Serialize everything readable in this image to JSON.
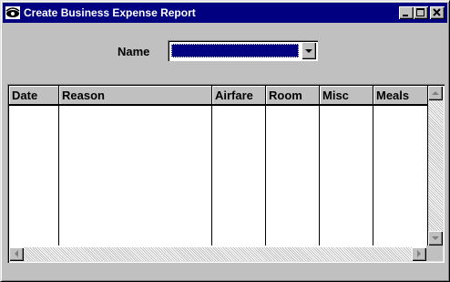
{
  "window": {
    "title": "Create Business Expense Report"
  },
  "form": {
    "name_label": "Name",
    "name_value": ""
  },
  "grid": {
    "columns": [
      {
        "label": "Date"
      },
      {
        "label": "Reason"
      },
      {
        "label": "Airfare"
      },
      {
        "label": "Room"
      },
      {
        "label": "Misc"
      },
      {
        "label": "Meals"
      }
    ],
    "rows": []
  },
  "icons": {
    "app": "eye-icon",
    "minimize": "minimize-icon",
    "maximize": "maximize-icon",
    "close": "close-icon",
    "dropdown": "chevron-down-icon"
  },
  "colors": {
    "titlebar": "#000080",
    "face": "#c0c0c0",
    "selection": "#000080"
  }
}
